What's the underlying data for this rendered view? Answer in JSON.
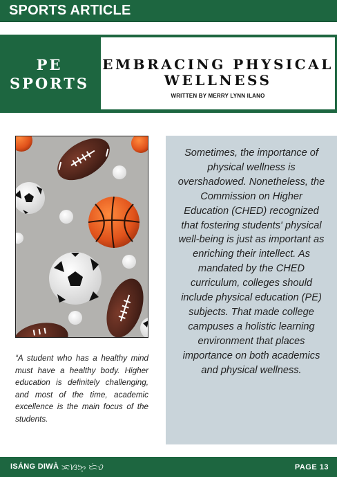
{
  "header": {
    "section_tag": "SPORTS ARTICLE"
  },
  "banner": {
    "category_line1": "PE",
    "category_line2": "SPORTS",
    "title_line1": "EMBRACING PHYSICAL",
    "title_line2": "WELLNESS",
    "byline": "WRITTEN BY MERRY LYNN ILANO"
  },
  "image": {
    "subject": "sports balls pattern: american footballs, soccer balls, basketballs, ping-pong balls on grey"
  },
  "quote": {
    "text": "“A student who has a healthy mind must have a healthy body. Higher education is definitely challenging, and most of the time, academic excellence is the main focus of the students."
  },
  "article": {
    "body": "Sometimes, the importance of physical wellness is overshadowed. Nonetheless, the Commission on Higher Education (CHED) recognized that fostering students' physical well-being is just as important as enriching their intellect. As mandated by the CHED curriculum, colleges should include physical education (PE) subjects. That made college campuses a holistic learning environment that places importance on both academics and physical wellness."
  },
  "footer": {
    "brand": "ISÁNG DIWÀ",
    "brand_script": "ᜁᜐᜅ᜔ ᜇᜒᜏ",
    "page": "PAGE 13"
  },
  "colors": {
    "brand_green": "#1d6640",
    "article_panel": "#c9d4da",
    "photo_background": "#b1b0ad"
  }
}
